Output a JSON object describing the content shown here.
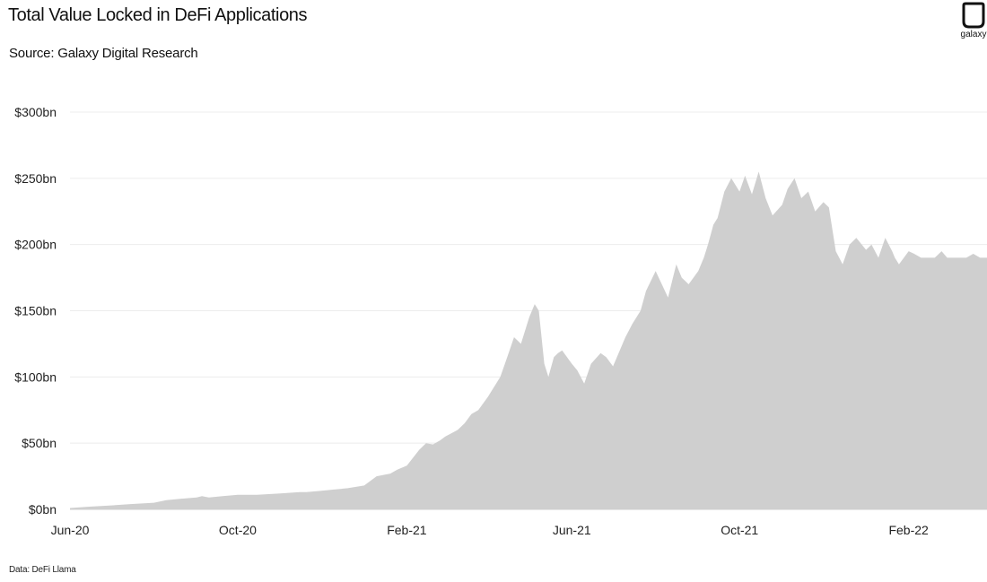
{
  "header": {
    "title": "Total Value Locked in DeFi Applications",
    "subtitle": "Source: Galaxy Digital Research"
  },
  "footer": {
    "note": "Data: DeFi Llama"
  },
  "logo": {
    "text": "galaxy"
  },
  "chart_data": {
    "type": "area",
    "title": "Total Value Locked in DeFi Applications",
    "xlabel": "",
    "ylabel": "",
    "ylim": [
      0,
      300
    ],
    "xlim": [
      "2020-06-01",
      "2022-03-30"
    ],
    "y_ticks": [
      "$0bn",
      "$50bn",
      "$100bn",
      "$150bn",
      "$200bn",
      "$250bn",
      "$300bn"
    ],
    "x_ticks": [
      {
        "label": "Jun-20",
        "date": "2020-06-01"
      },
      {
        "label": "Oct-20",
        "date": "2020-10-01"
      },
      {
        "label": "Feb-21",
        "date": "2021-02-01"
      },
      {
        "label": "Jun-21",
        "date": "2021-06-01"
      },
      {
        "label": "Oct-21",
        "date": "2021-10-01"
      },
      {
        "label": "Feb-22",
        "date": "2022-02-01"
      }
    ],
    "grid": true,
    "color": "#cfcfcf",
    "series": [
      {
        "x": [
          "2020-06-01",
          "2020-06-15",
          "2020-07-01",
          "2020-07-15",
          "2020-08-01",
          "2020-08-10",
          "2020-08-20",
          "2020-09-01",
          "2020-09-05",
          "2020-09-10",
          "2020-09-20",
          "2020-10-01",
          "2020-10-15",
          "2020-11-01",
          "2020-11-15",
          "2020-11-20",
          "2020-12-01",
          "2020-12-10",
          "2020-12-20",
          "2021-01-01",
          "2021-01-10",
          "2021-01-20",
          "2021-01-25",
          "2021-02-01",
          "2021-02-10",
          "2021-02-15",
          "2021-02-20",
          "2021-02-25",
          "2021-03-01",
          "2021-03-10",
          "2021-03-15",
          "2021-03-20",
          "2021-03-25",
          "2021-04-01",
          "2021-04-10",
          "2021-04-15",
          "2021-04-20",
          "2021-04-25",
          "2021-05-01",
          "2021-05-05",
          "2021-05-08",
          "2021-05-12",
          "2021-05-15",
          "2021-05-19",
          "2021-05-22",
          "2021-05-25",
          "2021-06-01",
          "2021-06-05",
          "2021-06-10",
          "2021-06-15",
          "2021-06-22",
          "2021-06-26",
          "2021-07-01",
          "2021-07-10",
          "2021-07-15",
          "2021-07-21",
          "2021-07-25",
          "2021-08-01",
          "2021-08-10",
          "2021-08-16",
          "2021-08-20",
          "2021-08-25",
          "2021-09-01",
          "2021-09-05",
          "2021-09-08",
          "2021-09-12",
          "2021-09-15",
          "2021-09-20",
          "2021-09-25",
          "2021-10-01",
          "2021-10-05",
          "2021-10-10",
          "2021-10-15",
          "2021-10-20",
          "2021-10-25",
          "2021-11-01",
          "2021-11-05",
          "2021-11-10",
          "2021-11-15",
          "2021-11-20",
          "2021-11-25",
          "2021-12-01",
          "2021-12-05",
          "2021-12-10",
          "2021-12-15",
          "2021-12-20",
          "2021-12-25",
          "2022-01-01",
          "2022-01-05",
          "2022-01-10",
          "2022-01-15",
          "2022-01-20",
          "2022-01-22",
          "2022-01-25",
          "2022-02-01",
          "2022-02-05",
          "2022-02-10",
          "2022-02-15",
          "2022-02-20",
          "2022-02-25",
          "2022-03-01",
          "2022-03-10",
          "2022-03-15",
          "2022-03-20",
          "2022-03-25",
          "2022-03-30"
        ],
        "y": [
          1,
          2,
          3,
          4,
          5,
          7,
          8,
          9,
          10,
          9,
          10,
          11,
          11,
          12,
          13,
          13,
          14,
          15,
          16,
          18,
          25,
          27,
          30,
          33,
          45,
          50,
          49,
          52,
          55,
          60,
          65,
          72,
          75,
          85,
          100,
          115,
          130,
          125,
          145,
          155,
          150,
          110,
          100,
          115,
          118,
          120,
          110,
          105,
          95,
          110,
          118,
          115,
          108,
          130,
          140,
          150,
          165,
          180,
          160,
          185,
          175,
          170,
          180,
          190,
          200,
          215,
          220,
          240,
          250,
          240,
          252,
          238,
          255,
          235,
          222,
          230,
          242,
          250,
          235,
          240,
          225,
          232,
          228,
          195,
          185,
          200,
          205,
          196,
          200,
          190,
          205,
          195,
          190,
          185,
          195,
          193,
          190,
          190,
          190,
          195,
          190,
          190,
          190,
          193,
          190,
          190
        ]
      }
    ]
  }
}
